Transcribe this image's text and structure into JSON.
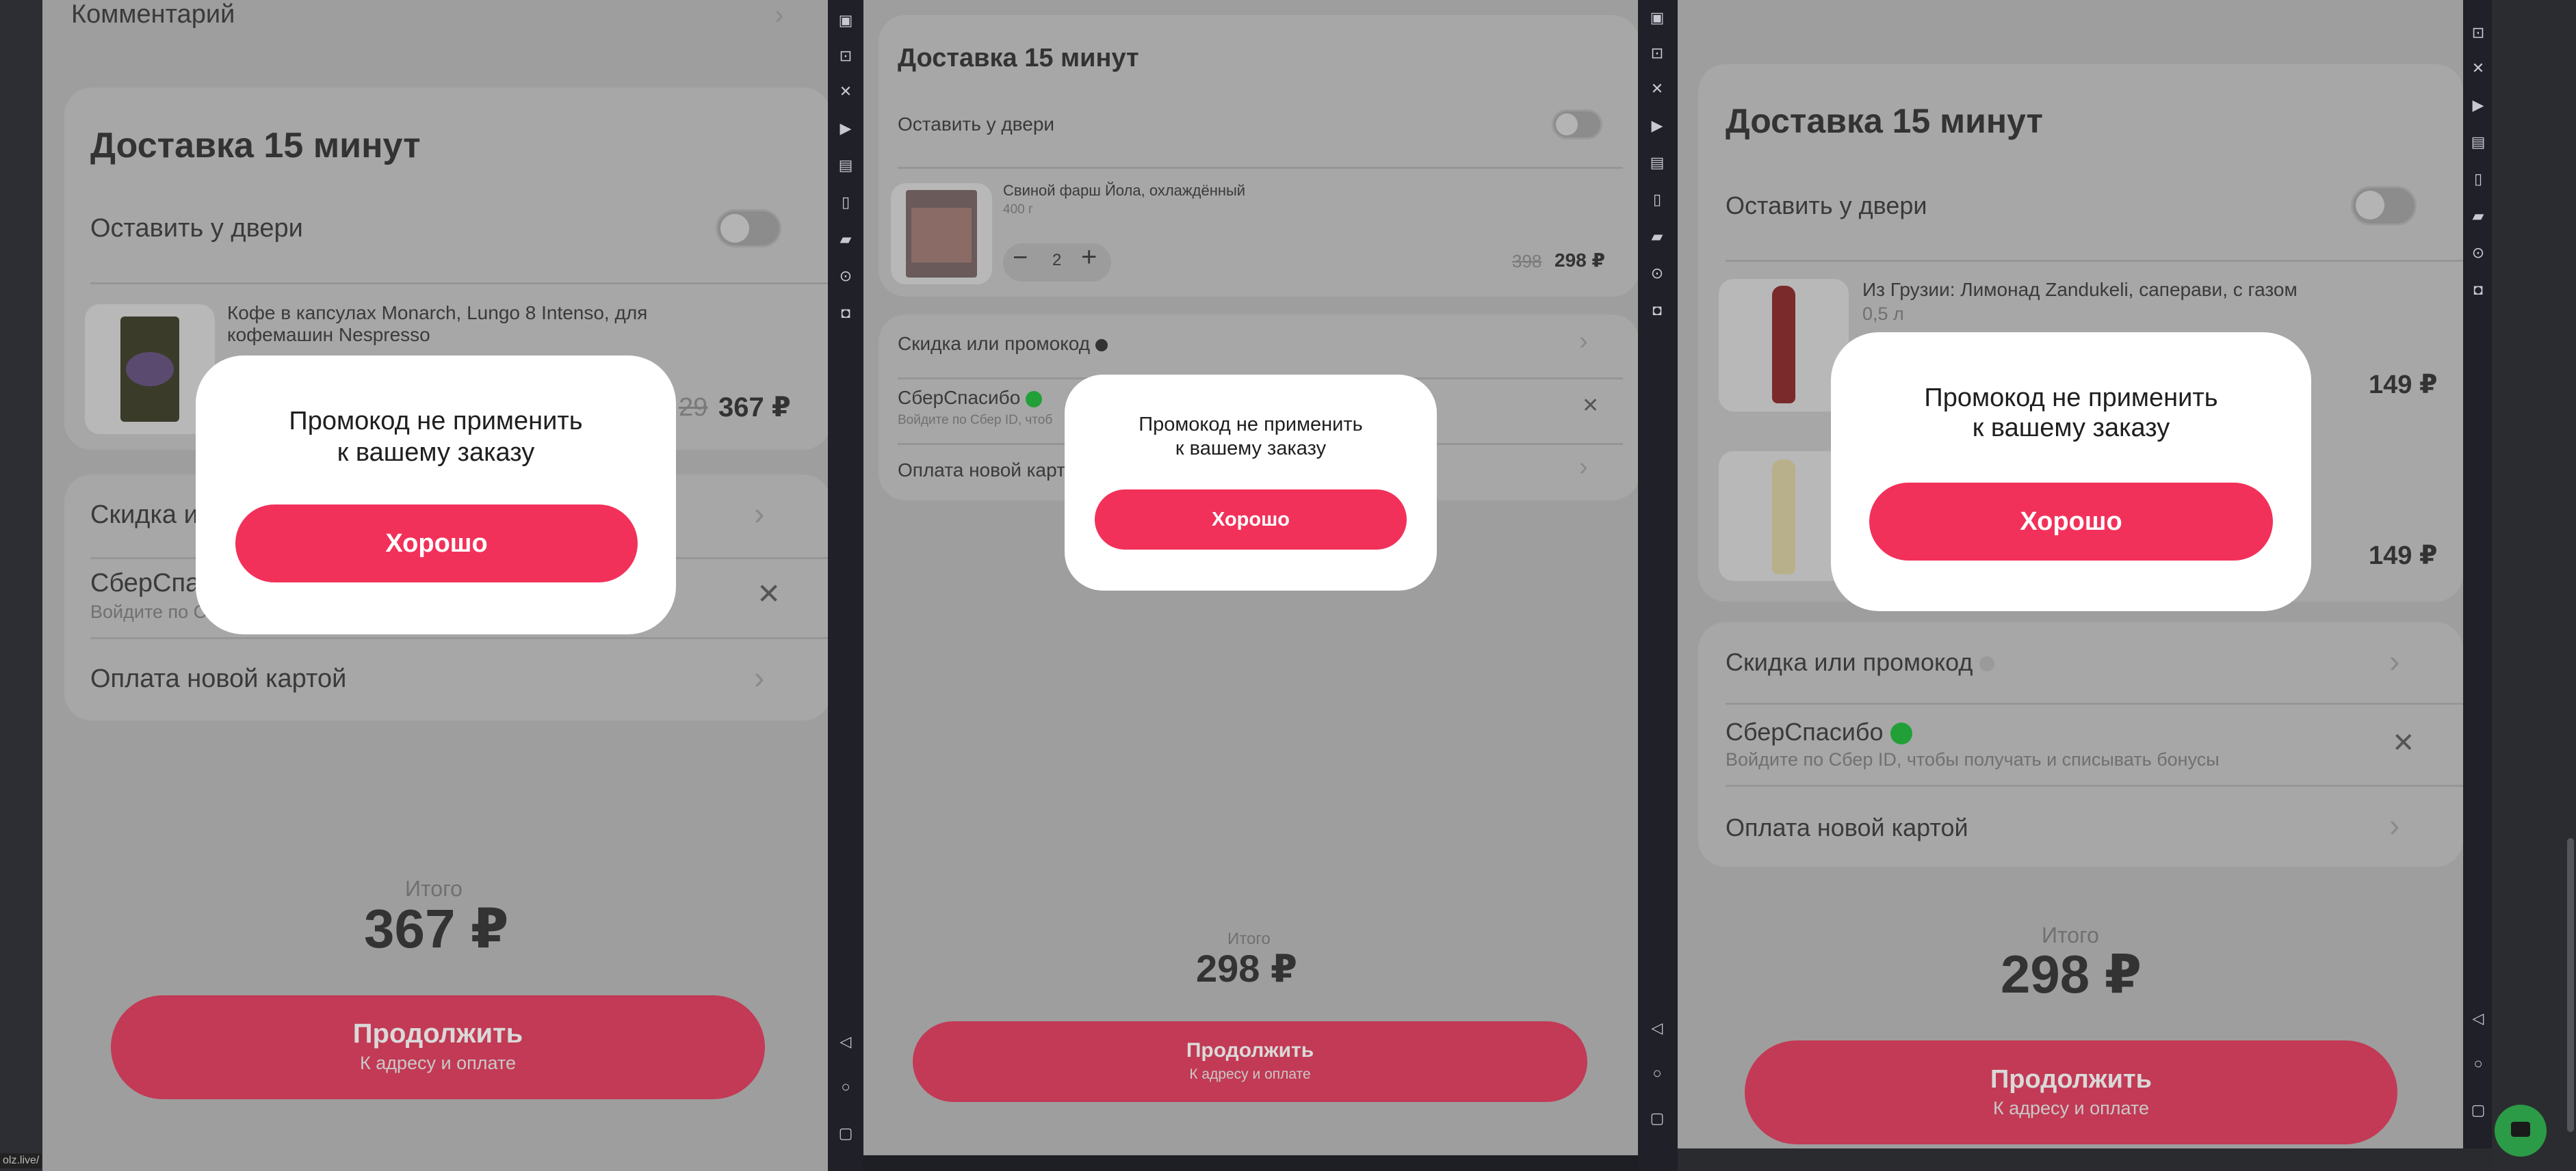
{
  "delivery_title": "Доставка 15 минут",
  "leave_at_door": "Оставить у двери",
  "discount_label": "Скидка или промокод",
  "sber_label": "СберСпасибо",
  "sber_sub_full": "Войдите по Сбер ID, чтобы получать и списывать бонусы",
  "sber_sub_cut_1": "Войдите по С",
  "sber_sub_cut_2": "Войдите по Сбер ID, чтоб",
  "new_card_label": "Оплата новой картой",
  "new_card_cut_2": "Оплата новой карт",
  "discount_cut_1": "Скидка и",
  "sber_cut_1": "СберСпас",
  "total_label": "Итого",
  "continue_label": "Продолжить",
  "continue_sub": "К адресу и оплате",
  "modal": {
    "title_line1": "Промокод не применить",
    "title_line2": "к вашему заказу",
    "ok": "Хорошо"
  },
  "browser_status": "olz.live/",
  "colors": {
    "accent": "#f2315a",
    "sber_green": "#21a038"
  },
  "panel1": {
    "comment_label": "Комментарий",
    "product_name_line1": "Кофе в капсулах Monarch, Lungo 8 Intenso, для",
    "product_name_line2": "кофемашин Nespresso",
    "old_price_cut": "29",
    "price": "367 ₽",
    "total": "367 ₽"
  },
  "panel2": {
    "product_name": "Свиной фарш Йола, охлаждённый",
    "product_weight": "400 г",
    "quantity": "2",
    "old_price": "398",
    "price": "298 ₽",
    "total": "298 ₽"
  },
  "panel3": {
    "product1_name": "Из Грузии: Лимонад Zandukeli, саперави, с газом",
    "product1_volume": "0,5 л",
    "product1_price": "149 ₽",
    "product2_price": "149 ₽",
    "total": "298 ₽"
  },
  "toolbar_icons": [
    "screenshot-icon",
    "robot-icon",
    "close-icon",
    "video-icon",
    "message-icon",
    "phone-icon",
    "folder-icon",
    "location-icon",
    "camera-icon",
    "back-icon",
    "home-icon",
    "recents-icon"
  ]
}
